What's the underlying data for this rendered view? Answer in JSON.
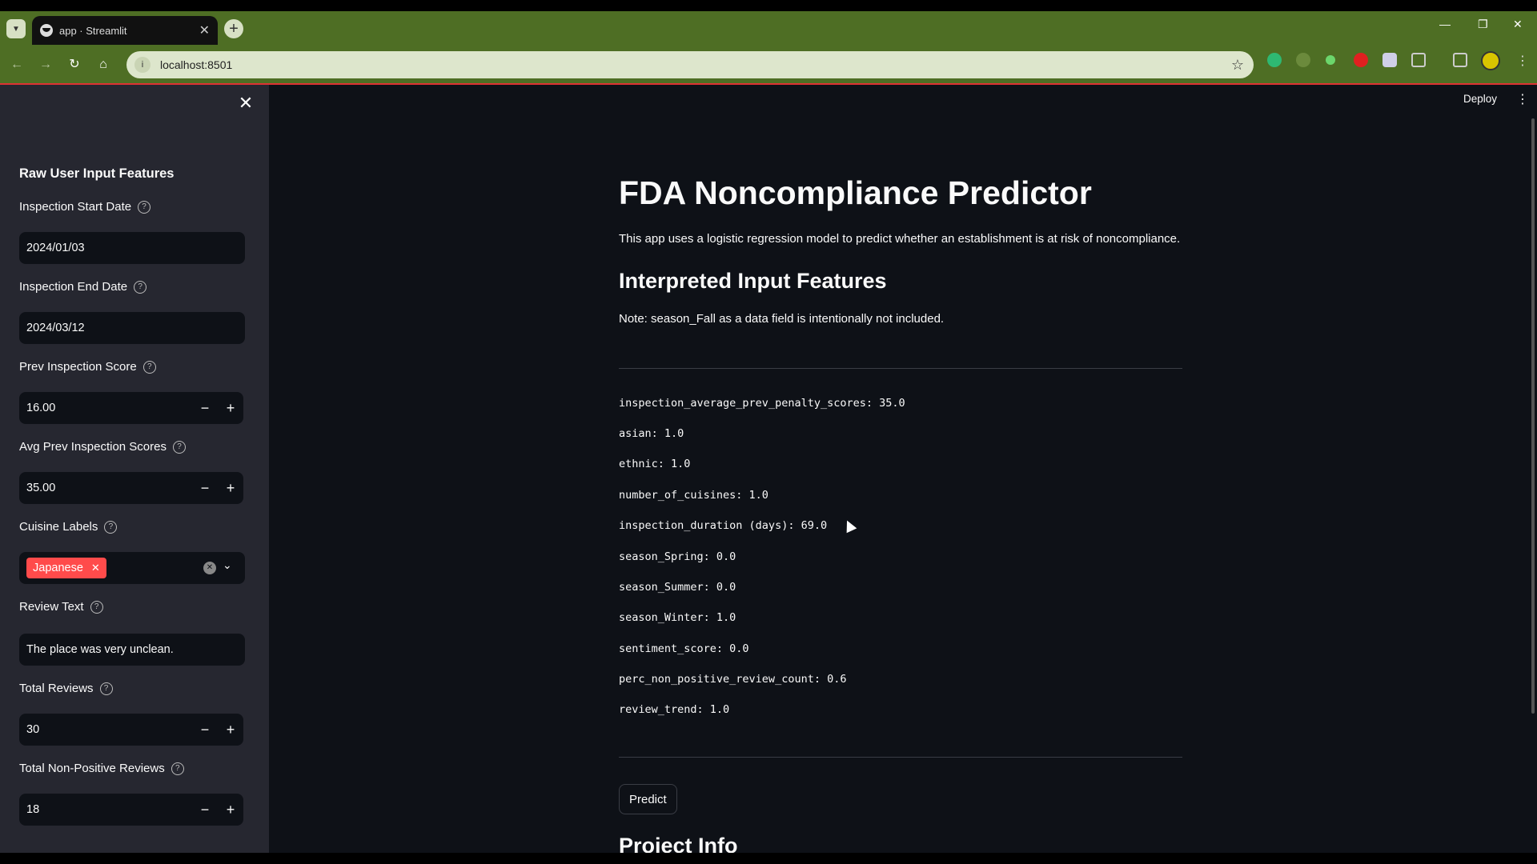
{
  "browser": {
    "tab_title": "app · Streamlit",
    "url": "localhost:8501",
    "accent": "#4e6e24"
  },
  "sidebar": {
    "title": "Raw User Input Features",
    "fields": {
      "start_date": {
        "label": "Inspection Start Date",
        "value": "2024/01/03"
      },
      "end_date": {
        "label": "Inspection End Date",
        "value": "2024/03/12"
      },
      "prev_score": {
        "label": "Prev Inspection Score",
        "value": "16.00"
      },
      "avg_prev": {
        "label": "Avg Prev Inspection Scores",
        "value": "35.00"
      },
      "cuisine": {
        "label": "Cuisine Labels",
        "tag": "Japanese"
      },
      "review_text": {
        "label": "Review Text",
        "value": "The place was very unclean."
      },
      "total_reviews": {
        "label": "Total Reviews",
        "value": "30"
      },
      "non_positive": {
        "label": "Total Non-Positive Reviews",
        "value": "18"
      }
    },
    "minus": "−",
    "plus": "+"
  },
  "header": {
    "deploy": "Deploy"
  },
  "main": {
    "title": "FDA Noncompliance Predictor",
    "description": "This app uses a logistic regression model to predict whether an establishment is at risk of noncompliance.",
    "subtitle": "Interpreted Input Features",
    "note": "Note: season_Fall as a data field is intentionally not included.",
    "features": [
      "inspection_average_prev_penalty_scores: 35.0",
      "asian: 1.0",
      "ethnic: 1.0",
      "number_of_cuisines: 1.0",
      "inspection_duration (days): 69.0",
      "season_Spring: 0.0",
      "season_Summer: 0.0",
      "season_Winter: 1.0",
      "sentiment_score: 0.0",
      "perc_non_positive_review_count: 0.6",
      "review_trend: 1.0"
    ],
    "predict_label": "Predict",
    "project_info": "Project Info"
  }
}
